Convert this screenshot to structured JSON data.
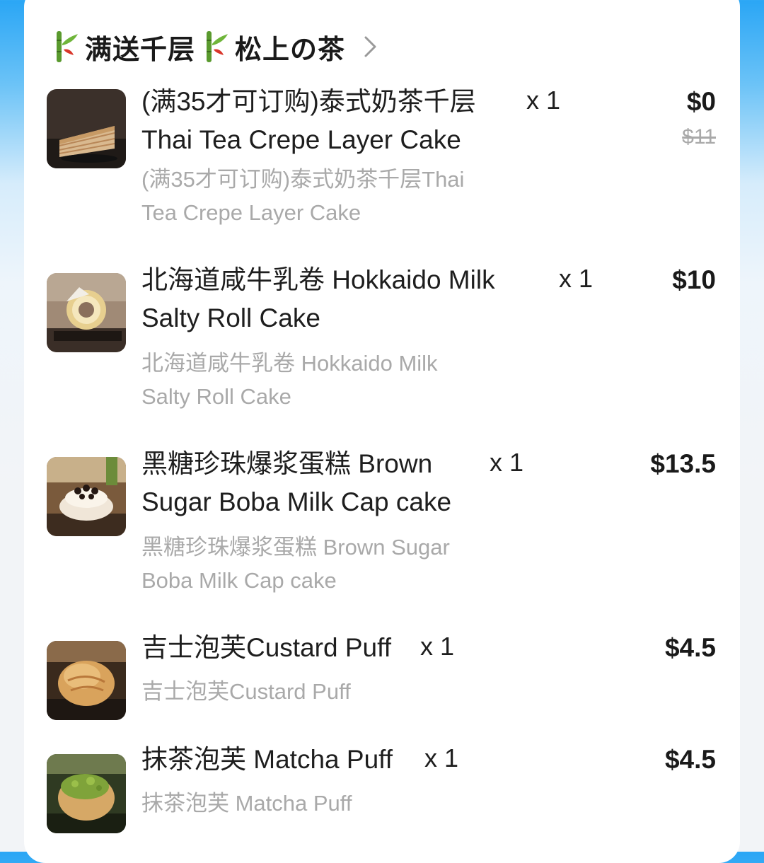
{
  "header": {
    "title_part1": "满送千层",
    "title_part2": "松上の茶",
    "leaf_icon": "bamboo-leaf-icon",
    "chevron_icon": "chevron-right-icon"
  },
  "items": [
    {
      "name_line1": "(满35才可订购)泰式奶茶千层",
      "name_line2": "Thai Tea Crepe Layer Cake",
      "qty": "x 1",
      "price": "$0",
      "original_price": "$11",
      "sub_line1": "(满35才可订购)泰式奶茶千层Thai",
      "sub_line2": "Tea Crepe Layer Cake"
    },
    {
      "name_line1": "北海道咸牛乳卷 Hokkaido Milk",
      "name_line2": "Salty Roll Cake",
      "qty": "x 1",
      "price": "$10",
      "sub_line1": "北海道咸牛乳卷 Hokkaido Milk",
      "sub_line2": "Salty Roll Cake"
    },
    {
      "name_line1": "黑糖珍珠爆浆蛋糕 Brown",
      "name_line2": "Sugar Boba Milk Cap cake",
      "qty": "x 1",
      "price": "$13.5",
      "sub_line1": "黑糖珍珠爆浆蛋糕 Brown Sugar",
      "sub_line2": "Boba Milk Cap cake"
    },
    {
      "name_line1": "吉士泡芙Custard Puff",
      "qty": "x 1",
      "price": "$4.5",
      "sub_line1": "吉士泡芙Custard Puff"
    },
    {
      "name_line1": "抹茶泡芙 Matcha Puff",
      "qty": "x 1",
      "price": "$4.5",
      "sub_line1": "抹茶泡芙 Matcha Puff"
    }
  ]
}
